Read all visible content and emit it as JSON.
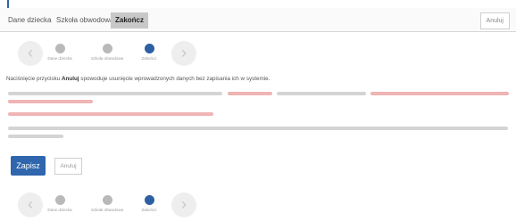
{
  "tabs": [
    {
      "label": "Dane dziecka"
    },
    {
      "label": "Szkoła obwodowa"
    },
    {
      "label": "Zakończ"
    }
  ],
  "header": {
    "cancel_label": "Anuluj"
  },
  "wizard": {
    "steps": [
      {
        "label": "Dane dziecka"
      },
      {
        "label": "Szkoła obwodowa"
      },
      {
        "label": "Zakończ"
      }
    ],
    "prev_icon": "chevron-left-icon",
    "next_icon": "chevron-right-icon"
  },
  "info": {
    "prefix": "Naciśnięcie przycisku ",
    "bold": "Anuluj",
    "suffix": " spowoduje usunięcie wprowadzonych danych bez zapisania ich w systemie."
  },
  "actions": {
    "save_label": "Zapisz",
    "cancel_label": "Anuluj"
  },
  "colors": {
    "accent": "#2f66ad",
    "current_step": "#2d5fa3",
    "warning_text": "#e05a5a"
  }
}
